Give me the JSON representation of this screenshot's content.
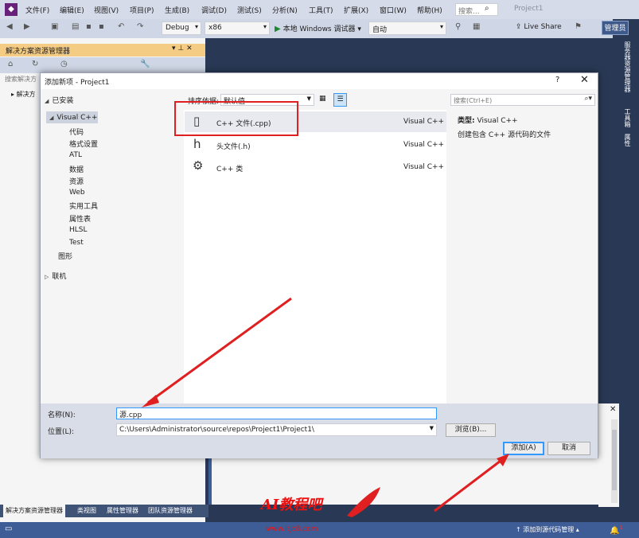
{
  "menu": {
    "items": [
      "文件(F)",
      "编辑(E)",
      "视图(V)",
      "项目(P)",
      "生成(B)",
      "调试(D)",
      "测试(S)",
      "分析(N)",
      "工具(T)",
      "扩展(X)",
      "窗口(W)",
      "帮助(H)"
    ],
    "search_placeholder": "搜索...",
    "project_title": "Project1"
  },
  "toolbar": {
    "config": "Debug",
    "platform": "x86",
    "run_label": "本地 Windows 调试器",
    "run_mode": "自动",
    "live_share": "Live Share",
    "admin": "管理员"
  },
  "solution_explorer": {
    "title": "解决方案资源管理器",
    "search_placeholder": "搜索解决方",
    "tree_top": "解决方",
    "tabs": [
      "解决方案资源管理器",
      "类视图",
      "属性管理器",
      "团队资源管理器"
    ]
  },
  "right_tabs": [
    "服务器资源管理器",
    "工具箱",
    "属性"
  ],
  "dialog": {
    "title": "添加新项 - Project1",
    "help": "?",
    "close": "✕",
    "installed_label": "已安装",
    "tree_root": "Visual C++",
    "tree_children": [
      "代码",
      "格式设置",
      "ATL",
      "数据",
      "资源",
      "Web",
      "实用工具",
      "属性表",
      "HLSL",
      "Test"
    ],
    "tree_graphics": "图形",
    "tree_online": "联机",
    "sort_label": "排序依据:",
    "sort_value": "默认值",
    "search_placeholder": "搜索(Ctrl+E)",
    "items": [
      {
        "name": "C++ 文件(.cpp)",
        "type": "Visual C++",
        "icon": "cpp-file-icon"
      },
      {
        "name": "头文件(.h)",
        "type": "Visual C++",
        "icon": "header-file-icon"
      },
      {
        "name": "C++ 类",
        "type": "Visual C++",
        "icon": "cpp-class-icon"
      }
    ],
    "desc_type_label": "类型:",
    "desc_type_value": "Visual C++",
    "desc_text": "创建包含 C++ 源代码的文件",
    "name_label": "名称(N):",
    "name_value": "源.cpp",
    "location_label": "位置(L):",
    "location_value": "C:\\Users\\Administrator\\source\\repos\\Project1\\Project1\\",
    "browse_label": "浏览(B)...",
    "add_label": "添加(A)",
    "cancel_label": "取消"
  },
  "status": {
    "add_to_source": "添加到源代码管理",
    "notify_count": "1"
  },
  "watermark": {
    "text": "AI教程吧",
    "url": "www.itjc8.com"
  },
  "colors": {
    "vs_purple": "#68217a",
    "panel_title": "#f5cc84",
    "statusbar": "#3e5d96",
    "highlight": "#e02020",
    "focus_blue": "#3399ff"
  }
}
